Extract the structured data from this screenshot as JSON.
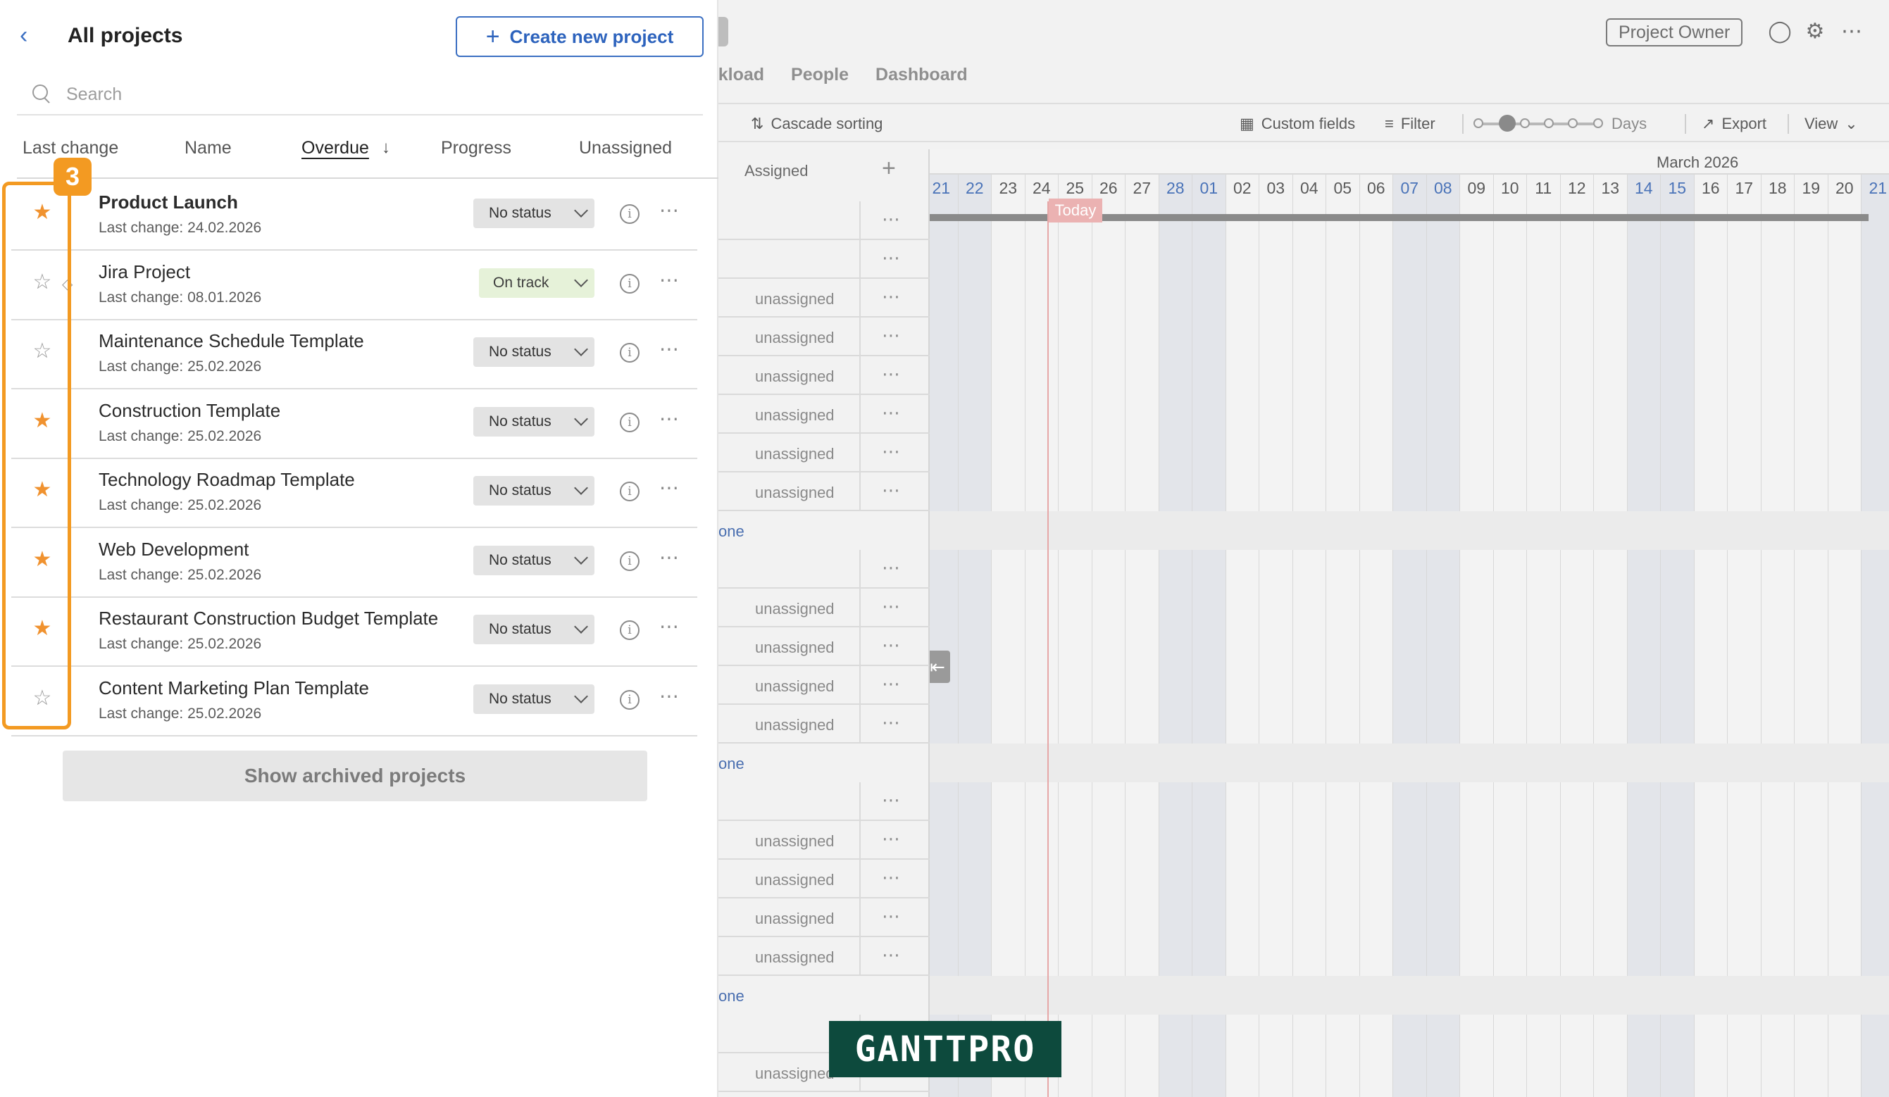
{
  "header": {
    "owner_label": "Project Owner",
    "tabs": [
      "rkload",
      "People",
      "Dashboard"
    ]
  },
  "toolbar": {
    "cascade_label": "Cascade sorting",
    "custom_fields_label": "Custom fields",
    "filter_label": "Filter",
    "scale_label": "Days",
    "export_label": "Export",
    "view_label": "View"
  },
  "grid": {
    "assigned_header": "Assigned",
    "rows": [
      {
        "label": ""
      },
      {
        "label": ""
      },
      {
        "label": "unassigned"
      },
      {
        "label": "unassigned"
      },
      {
        "label": "unassigned"
      },
      {
        "label": "unassigned"
      },
      {
        "label": "unassigned"
      },
      {
        "label": "unassigned"
      },
      {
        "group": "one"
      },
      {
        "label": ""
      },
      {
        "label": "unassigned"
      },
      {
        "label": "unassigned"
      },
      {
        "label": "unassigned"
      },
      {
        "label": "unassigned"
      },
      {
        "group": "one"
      },
      {
        "label": ""
      },
      {
        "label": "unassigned"
      },
      {
        "label": "unassigned"
      },
      {
        "label": "unassigned"
      },
      {
        "label": "unassigned"
      },
      {
        "group": "one"
      },
      {
        "label": ""
      },
      {
        "label": "unassigned"
      }
    ]
  },
  "timeline": {
    "month_label": "March 2026",
    "today_label": "Today",
    "days": [
      {
        "d": "21",
        "we": true
      },
      {
        "d": "22",
        "we": true
      },
      {
        "d": "23"
      },
      {
        "d": "24"
      },
      {
        "d": "25"
      },
      {
        "d": "26"
      },
      {
        "d": "27"
      },
      {
        "d": "28",
        "we": true
      },
      {
        "d": "01",
        "we": true
      },
      {
        "d": "02"
      },
      {
        "d": "03"
      },
      {
        "d": "04"
      },
      {
        "d": "05"
      },
      {
        "d": "06"
      },
      {
        "d": "07",
        "we": true
      },
      {
        "d": "08",
        "we": true
      },
      {
        "d": "09"
      },
      {
        "d": "10"
      },
      {
        "d": "11"
      },
      {
        "d": "12"
      },
      {
        "d": "13"
      },
      {
        "d": "14",
        "we": true
      },
      {
        "d": "15",
        "we": true
      },
      {
        "d": "16"
      },
      {
        "d": "17"
      },
      {
        "d": "18"
      },
      {
        "d": "19"
      },
      {
        "d": "20"
      },
      {
        "d": "21",
        "we": true
      }
    ]
  },
  "watermark": "GANTTPRO",
  "panel": {
    "title": "All projects",
    "create_label": "Create new project",
    "search_placeholder": "Search",
    "sort_columns": {
      "last_change": "Last change",
      "name": "Name",
      "overdue": "Overdue",
      "progress": "Progress",
      "unassigned": "Unassigned"
    },
    "step_badge": "3",
    "projects": [
      {
        "name": "Product Launch",
        "last_change": "Last change: 24.02.2026",
        "status": "No status",
        "starred": true,
        "bold": true
      },
      {
        "name": "Jira Project",
        "last_change": "Last change: 08.01.2026",
        "status": "On track",
        "starred": false
      },
      {
        "name": "Maintenance Schedule Template",
        "last_change": "Last change: 25.02.2026",
        "status": "No status",
        "starred": false
      },
      {
        "name": "Construction Template",
        "last_change": "Last change: 25.02.2026",
        "status": "No status",
        "starred": true
      },
      {
        "name": "Technology Roadmap Template",
        "last_change": "Last change: 25.02.2026",
        "status": "No status",
        "starred": true
      },
      {
        "name": "Web Development",
        "last_change": "Last change: 25.02.2026",
        "status": "No status",
        "starred": true
      },
      {
        "name": "Restaurant Construction Budget Template",
        "last_change": "Last change: 25.02.2026",
        "status": "No status",
        "starred": true
      },
      {
        "name": "Content Marketing Plan Template",
        "last_change": "Last change: 25.02.2026",
        "status": "No status",
        "starred": false
      }
    ],
    "archived_label": "Show archived projects"
  }
}
